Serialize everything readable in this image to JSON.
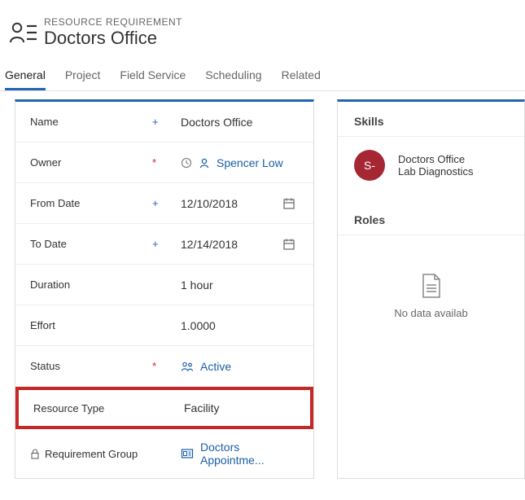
{
  "header": {
    "entity_type": "RESOURCE REQUIREMENT",
    "title": "Doctors Office"
  },
  "tabs": [
    {
      "label": "General",
      "active": true
    },
    {
      "label": "Project",
      "active": false
    },
    {
      "label": "Field Service",
      "active": false
    },
    {
      "label": "Scheduling",
      "active": false
    },
    {
      "label": "Related",
      "active": false
    }
  ],
  "fields": {
    "name": {
      "label": "Name",
      "value": "Doctors Office"
    },
    "owner": {
      "label": "Owner",
      "value": "Spencer Low"
    },
    "from_date": {
      "label": "From Date",
      "value": "12/10/2018"
    },
    "to_date": {
      "label": "To Date",
      "value": "12/14/2018"
    },
    "duration": {
      "label": "Duration",
      "value": "1 hour"
    },
    "effort": {
      "label": "Effort",
      "value": "1.0000"
    },
    "status": {
      "label": "Status",
      "value": "Active"
    },
    "resource_type": {
      "label": "Resource Type",
      "value": "Facility"
    },
    "req_group": {
      "label": "Requirement Group",
      "value": "Doctors Appointme..."
    }
  },
  "right": {
    "skills_header": "Skills",
    "avatar_initial": "S-",
    "skill_line1": "Doctors Office",
    "skill_line2": "Lab Diagnostics",
    "roles_header": "Roles",
    "roles_empty": "No data availab"
  }
}
